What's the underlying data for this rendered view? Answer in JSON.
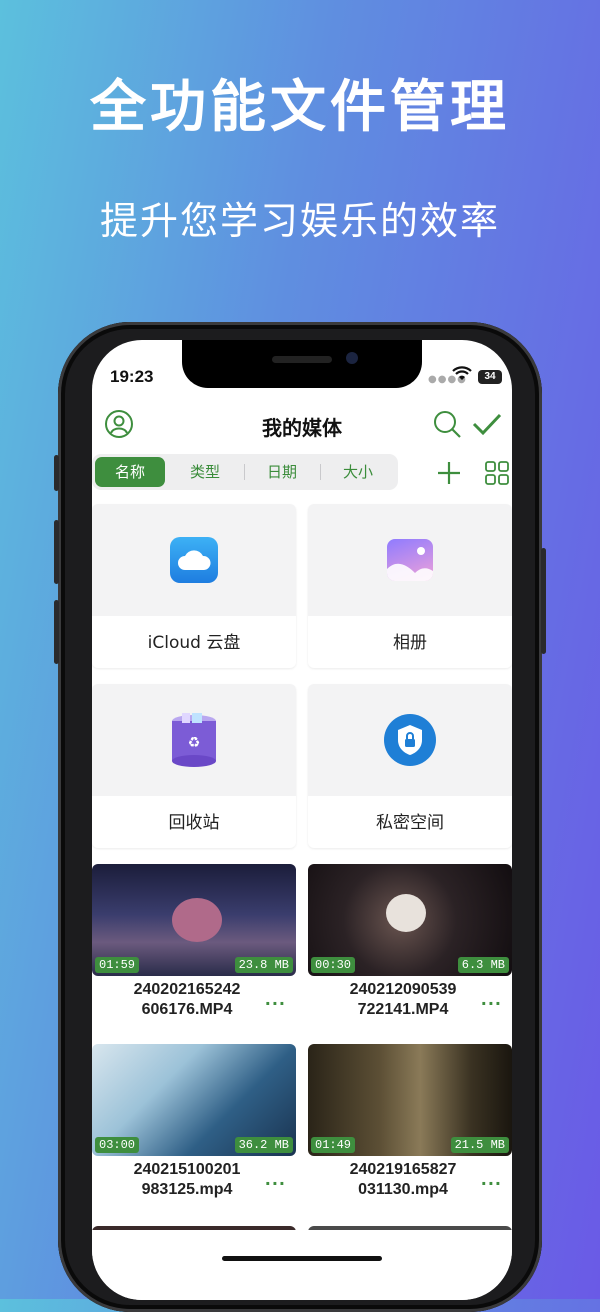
{
  "promo": {
    "headline": "全功能文件管理",
    "subline": "提升您学习娱乐的效率"
  },
  "status_bar": {
    "time": "19:23",
    "battery": "34"
  },
  "navbar": {
    "title": "我的媒体"
  },
  "sort_tabs": [
    {
      "label": "名称",
      "active": true
    },
    {
      "label": "类型",
      "active": false
    },
    {
      "label": "日期",
      "active": false
    },
    {
      "label": "大小",
      "active": false
    }
  ],
  "folders": [
    {
      "label": "iCloud 云盘",
      "icon": "icloud-icon"
    },
    {
      "label": "相册",
      "icon": "photos-icon"
    },
    {
      "label": "回收站",
      "icon": "trash-icon"
    },
    {
      "label": "私密空间",
      "icon": "shield-lock-icon"
    }
  ],
  "videos": [
    {
      "duration": "01:59",
      "size": "23.8 MB",
      "name_line1": "240202165242",
      "name_line2": "606176.MP4",
      "more": "..."
    },
    {
      "duration": "00:30",
      "size": "6.3 MB",
      "name_line1": "240212090539",
      "name_line2": "722141.MP4",
      "more": "..."
    },
    {
      "duration": "03:00",
      "size": "36.2 MB",
      "name_line1": "240215100201",
      "name_line2": "983125.mp4",
      "more": "..."
    },
    {
      "duration": "01:49",
      "size": "21.5 MB",
      "name_line1": "240219165827",
      "name_line2": "031130.mp4",
      "more": "..."
    }
  ],
  "colors": {
    "accent": "#3e8e3e",
    "background_start": "#5cc0dd",
    "background_end": "#6a5ae6"
  }
}
